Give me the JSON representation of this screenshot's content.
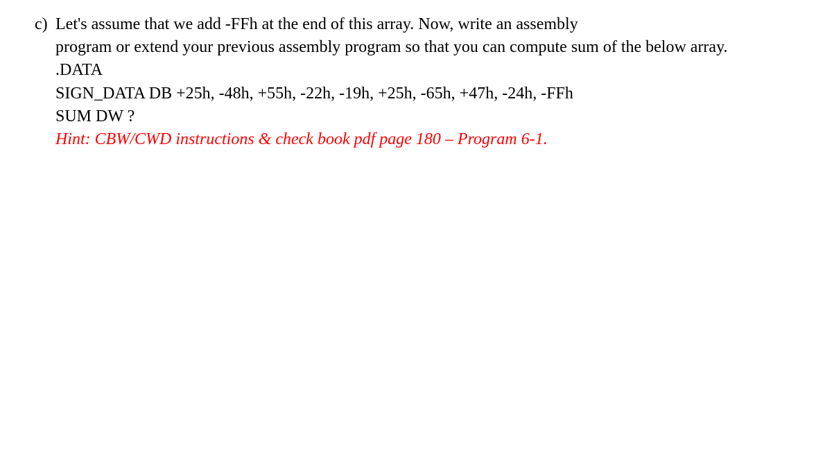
{
  "question": {
    "marker": "c)",
    "prompt_line1": "Let's assume that we add -FFh at the end of this array. Now, write an assembly",
    "prompt_line2": "program or extend your previous assembly program so that you can compute sum of the below array.",
    "data_header": ".DATA",
    "data_line": "SIGN_DATA DB +25h, -48h, +55h, -22h, -19h, +25h, -65h, +47h, -24h, -FFh",
    "sum_line": "SUM DW ?",
    "hint": "Hint: CBW/CWD instructions & check book pdf page 180 – Program 6-1."
  }
}
